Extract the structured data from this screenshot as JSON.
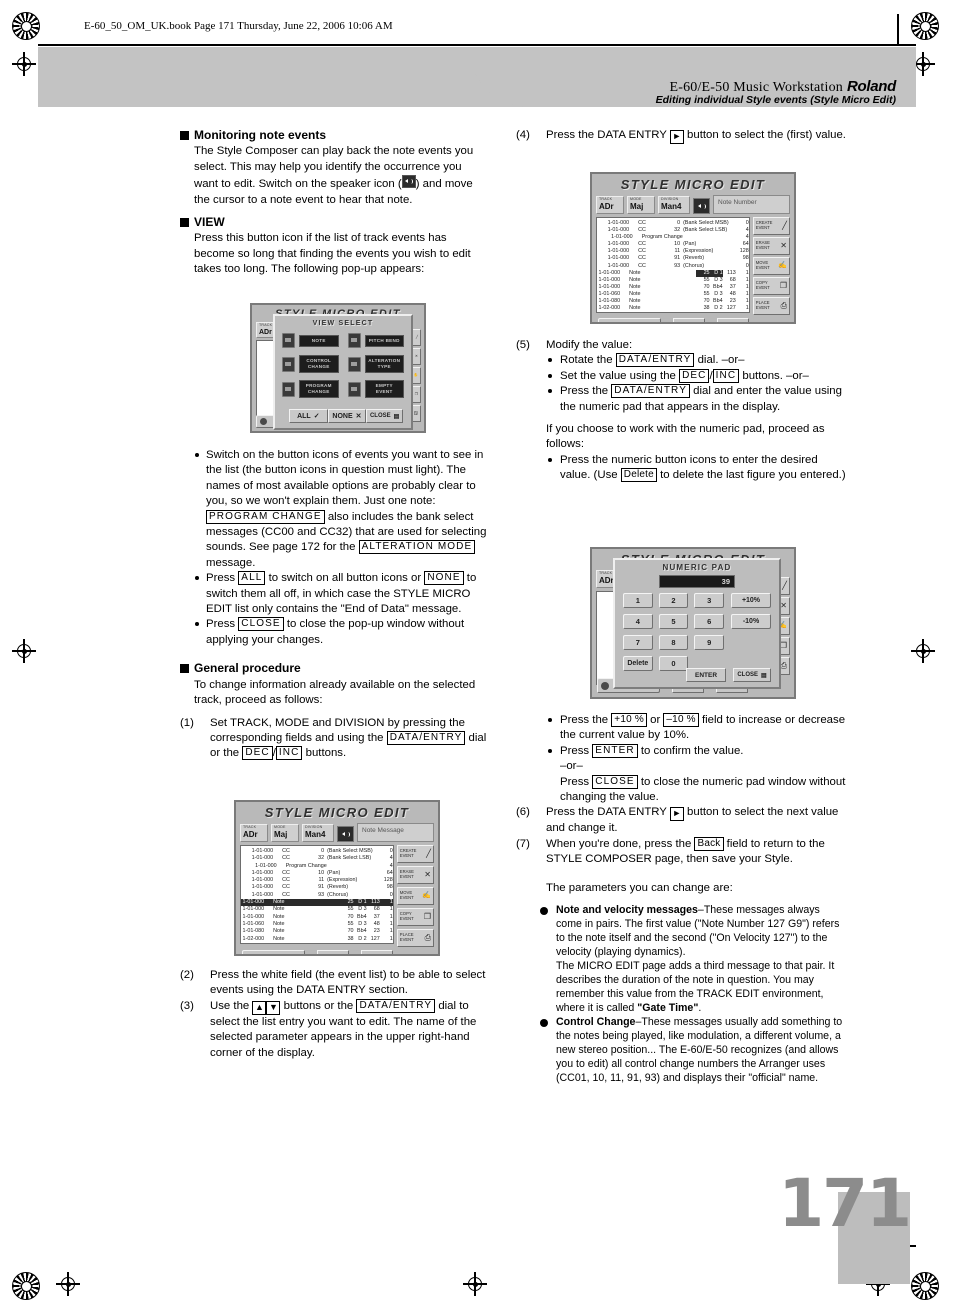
{
  "print_marks": {
    "book_line": "E-60_50_OM_UK.book  Page 171  Thursday, June 22, 2006  10:06 AM"
  },
  "header": {
    "product": "E-60/E-50 Music Workstation",
    "brand": "Roland",
    "subtitle": "Editing individual Style events (Style Micro Edit)"
  },
  "page_number": "171",
  "left_column": {
    "section1": {
      "heading": "Monitoring note events",
      "body_before_icon": "The Style Composer can play back the note events you select. This may help you identify the occurrence you want to edit. Switch on the speaker icon (",
      "icon_name": "speaker-icon",
      "body_after_icon": ") and move the cursor to a note event to hear that note."
    },
    "section2": {
      "heading": "VIEW",
      "body": "Press this button icon if the list of track events has become so long that finding the events you wish to edit takes too long. The following pop-up appears:"
    },
    "bullets": [
      {
        "p1": "Switch on the button icons of events you want to see in the list (the button icons in question must light). The names of most available options are probably clear to you, so we won't explain them. Just one note:",
        "key1": "PROGRAM CHANGE",
        "p2": "also includes the bank select messages (CC00 and CC32) that are used for selecting sounds. See page 172 for the",
        "key2": "ALTERATION MODE",
        "p3": "message."
      },
      {
        "p1": "Press",
        "key1": "ALL",
        "p2": "to switch on all button icons or",
        "key2": "NONE",
        "p3": "to switch them all off, in which case the STYLE MICRO EDIT list only contains the \"End of Data\" message."
      },
      {
        "p1": "Press",
        "key1": "CLOSE",
        "p2": "to close the pop-up window without applying your changes."
      }
    ],
    "section3": {
      "heading": "General procedure",
      "body": "To change information already available on the selected track, proceed as follows:"
    },
    "steps": [
      {
        "num": "(1)",
        "p1": "Set TRACK, MODE and DIVISION by pressing the corresponding fields and using the",
        "key1": "DATA/ENTRY",
        "p2": "dial or the",
        "key2": "DEC",
        "sep": "/",
        "key3": "INC",
        "p3": "buttons."
      },
      {
        "num": "(2)",
        "p1": "Press the white field (the event list) to be able to select events using the DATA ENTRY section."
      },
      {
        "num": "(3)",
        "p1": "Use the",
        "key_up": "▲",
        "key_down": "▼",
        "p2": "buttons or the",
        "key1": "DATA/ENTRY",
        "p3": "dial to select the list entry you want to edit.",
        "p4": "The name of the selected parameter appears in the upper right-hand corner of the display."
      }
    ]
  },
  "right_column": {
    "step4": {
      "num": "(4)",
      "p1": "Press the DATA ENTRY",
      "arrow": "►",
      "p2": "button to select the (first) value."
    },
    "step5": {
      "num": "(5)",
      "title": "Modify the value:",
      "bullets": [
        {
          "p1": "Rotate the",
          "key1": "DATA/ENTRY",
          "p2": "dial. –or–"
        },
        {
          "p1": "Set the value using the",
          "key1": "DEC",
          "sep": "/",
          "key2": "INC",
          "p2": "buttons. –or–"
        },
        {
          "p1": "Press the",
          "key1": "DATA/ENTRY",
          "p2": "dial and enter the value using the numeric pad that appears in the display."
        }
      ],
      "note": "If you choose to work with the numeric pad, proceed as follows:",
      "numpad_bullet": {
        "p1": "Press the numeric button icons to enter the desired value. (Use",
        "key1": "Delete",
        "p2": "to delete the last figure you entered.)"
      },
      "after_bullets": [
        {
          "p1": "Press the",
          "key1": "+10 %",
          "p2": "or",
          "key2": "–10 %",
          "p3": "field to increase or decrease the current value by 10%."
        },
        {
          "p1": "Press",
          "key1": "ENTER",
          "p2": "to confirm the value.",
          "orline": "–or–",
          "p3": "Press",
          "key2": "CLOSE",
          "p4": "to close the numeric pad window without changing the value."
        }
      ]
    },
    "step6": {
      "num": "(6)",
      "p1": "Press the DATA ENTRY",
      "arrow": "►",
      "p2": "button to select the next value and change it."
    },
    "step7": {
      "num": "(7)",
      "p1": "When you're done, press the",
      "key1": "Back",
      "p2": "field to return to the STYLE COMPOSER page, then save your Style."
    },
    "params_intro": "The parameters you can change are:",
    "params": [
      {
        "term": "Note and velocity messages",
        "dash": "–",
        "body": "These messages always come in pairs. The first value (\"Note Number 127 G9\") refers to the note itself and the second (\"On Velocity 127\") to the velocity (playing dynamics).",
        "body2_pre": "The MICRO EDIT page adds a third message to that pair. It describes the duration of the note in question. You may remember this value from the TRACK EDIT environment, where it is called ",
        "body2_bold": "\"Gate Time\"",
        "body2_post": "."
      },
      {
        "term": "Control Change",
        "dash": "–",
        "body": "These messages usually add something to the notes being played, like modulation, a different volume, a new stereo position... The E-60/E-50 recognizes (and allows you to edit) all control change numbers the Arranger uses (CC01, 10, 11, 91, 93) and displays their \"official\" name."
      }
    ]
  },
  "lcd_screens": {
    "title": "STYLE MICRO EDIT",
    "fields": [
      {
        "label": "TRACK",
        "value": "ADr"
      },
      {
        "label": "MODE",
        "value": "Maj"
      },
      {
        "label": "DIVISION",
        "value": "Man4"
      }
    ],
    "speaker_icon": "speaker-icon",
    "message_screen1": "Note Message",
    "message_screen2": "Note Number",
    "message_popup": "",
    "events": [
      {
        "pos": "1-01-000",
        "type": "CC",
        "num": "0",
        "name": "(Bank Select MSB)",
        "v1": "0",
        "v2": "",
        "v3": ""
      },
      {
        "pos": "1-01-000",
        "type": "CC",
        "num": "32",
        "name": "(Bank Select LSB)",
        "v1": "4",
        "v2": "",
        "v3": ""
      },
      {
        "pos": "1-01-000",
        "type": "Program Change",
        "num": "",
        "name": "",
        "v1": "4",
        "v2": "",
        "v3": ""
      },
      {
        "pos": "1-01-000",
        "type": "CC",
        "num": "10",
        "name": "(Pan)",
        "v1": "64",
        "v2": "",
        "v3": ""
      },
      {
        "pos": "1-01-000",
        "type": "CC",
        "num": "11",
        "name": "(Expression)",
        "v1": "128",
        "v2": "",
        "v3": ""
      },
      {
        "pos": "1-01-000",
        "type": "CC",
        "num": "91",
        "name": "(Reverb)",
        "v1": "98",
        "v2": "",
        "v3": ""
      },
      {
        "pos": "1-01-000",
        "type": "CC",
        "num": "93",
        "name": "(Chorus)",
        "v1": "0",
        "v2": "",
        "v3": ""
      },
      {
        "pos": "1-01-000",
        "type": "Note",
        "num": "",
        "name": "",
        "v1": "25",
        "v2": "D 1",
        "v3": "113",
        "v4": "1",
        "selected": true
      },
      {
        "pos": "1-01-000",
        "type": "Note",
        "num": "",
        "name": "",
        "v1": "55",
        "v2": "D 3",
        "v3": "68",
        "v4": "1"
      },
      {
        "pos": "1-01-000",
        "type": "Note",
        "num": "",
        "name": "",
        "v1": "70",
        "v2": "Bb4",
        "v3": "37",
        "v4": "1"
      },
      {
        "pos": "1-01-060",
        "type": "Note",
        "num": "",
        "name": "",
        "v1": "55",
        "v2": "D 3",
        "v3": "48",
        "v4": "1"
      },
      {
        "pos": "1-01-080",
        "type": "Note",
        "num": "",
        "name": "",
        "v1": "70",
        "v2": "Bb4",
        "v3": "23",
        "v4": "1"
      },
      {
        "pos": "1-02-000",
        "type": "Note",
        "num": "",
        "name": "",
        "v1": "38",
        "v2": "D 2",
        "v3": "127",
        "v4": "1"
      }
    ],
    "side_buttons": [
      {
        "line1": "CREATE",
        "line2": "EVENT",
        "icon": "pencil-icon"
      },
      {
        "line1": "ERASE",
        "line2": "EVENT",
        "icon": "scissors-icon"
      },
      {
        "line1": "MOVE",
        "line2": "EVENT",
        "icon": "hand-icon"
      },
      {
        "line1": "COPY",
        "line2": "EVENT",
        "icon": "copy-icon"
      },
      {
        "line1": "PLACE",
        "line2": "EVENT",
        "icon": "paste-icon"
      }
    ],
    "back_label": "Back",
    "view_label": "VIEW"
  },
  "view_select_popup": {
    "title": "VIEW SELECT",
    "options": [
      {
        "l1": "NOTE",
        "l2": ""
      },
      {
        "l1": "PITCH",
        "l2": "BEND"
      },
      {
        "l1": "CONTROL",
        "l2": "CHANGE"
      },
      {
        "l1": "ALTERATION",
        "l2": "TYPE"
      },
      {
        "l1": "PROGRAM",
        "l2": "CHANGE"
      },
      {
        "l1": "EMPTY",
        "l2": "EVENT"
      }
    ],
    "footer": [
      {
        "label": "ALL",
        "icon": "check-icon"
      },
      {
        "label": "NONE",
        "icon": "cross-icon"
      },
      {
        "label": "CLOSE",
        "icon": "close-icon"
      }
    ]
  },
  "numeric_pad_popup": {
    "title": "NUMERIC PAD",
    "value": "39",
    "keys": [
      "1",
      "2",
      "3",
      "4",
      "5",
      "6",
      "7",
      "8",
      "9"
    ],
    "delete_label": "Delete",
    "zero_label": "0",
    "plus_label": "+10%",
    "minus_label": "-10%",
    "enter_label": "ENTER",
    "close_label": "CLOSE"
  }
}
